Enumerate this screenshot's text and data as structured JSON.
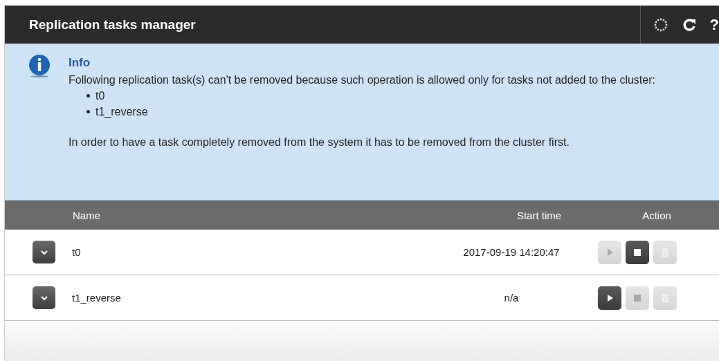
{
  "window": {
    "title": "Replication tasks manager",
    "help": "?"
  },
  "info": {
    "title": "Info",
    "message": "Following replication task(s) can't be removed because such operation is allowed only for tasks not added to the cluster:",
    "items": [
      "t0",
      "t1_reverse"
    ],
    "note": "In order to have a task completely removed from the system it has to be removed from the cluster first."
  },
  "table": {
    "columns": [
      "Name",
      "Start time",
      "Action"
    ],
    "rows": [
      {
        "name": "t0",
        "start_time": "2017-09-19 14:20:47",
        "expanded": false,
        "actions": [
          {
            "kind": "play",
            "disabled": true
          },
          {
            "kind": "stop",
            "disabled": false
          },
          {
            "kind": "delete",
            "disabled": true
          }
        ]
      },
      {
        "name": "t1_reverse",
        "start_time": "n/a",
        "expanded": false,
        "actions": [
          {
            "kind": "play",
            "disabled": false
          },
          {
            "kind": "stop",
            "disabled": true
          },
          {
            "kind": "delete",
            "disabled": true
          }
        ]
      }
    ]
  }
}
